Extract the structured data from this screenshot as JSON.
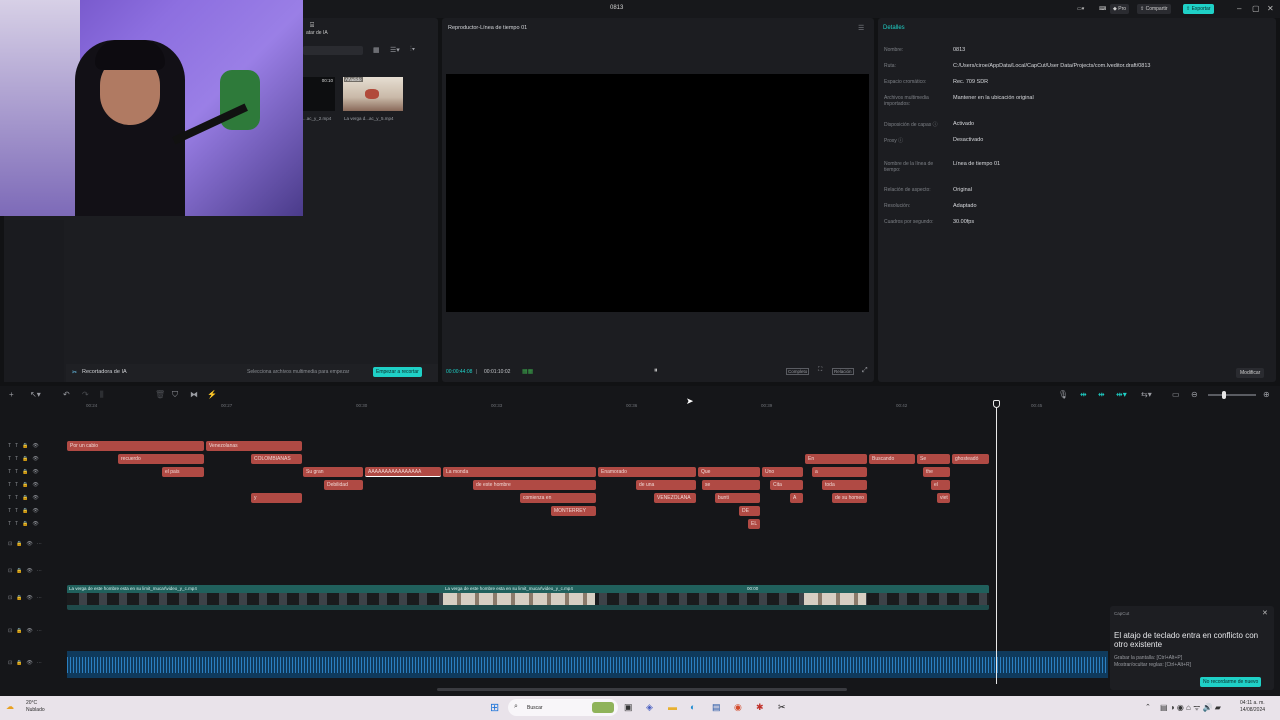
{
  "app": {
    "title": "0813"
  },
  "titlebar": {
    "pro_label": "Pro",
    "share_label": "Compartir",
    "export_label": "Exportar",
    "accent": "#1fd1c7"
  },
  "media": {
    "ai_tab_label": "atar de IA",
    "clips": [
      {
        "duration": "00:10",
        "name": "...ac_y_2.mp4"
      },
      {
        "badge": "Añadido",
        "name": "La verga d...ac_y_5.mp4"
      }
    ],
    "footer_title": "Recortadora de IA",
    "footer_hint": "Selecciona archivos multimedia para empezar",
    "footer_button": "Empezar a recortar"
  },
  "player": {
    "title": "Reproductor-Línea de tiempo 01",
    "current_time": "00:00:44:08",
    "total_time": "00:01:10:02",
    "ratio_label": "Completo",
    "ratio_label2": "Relación"
  },
  "details": {
    "header": "Detalles",
    "rows": [
      {
        "label": "Nombre:",
        "value": "0813"
      },
      {
        "label": "Ruta:",
        "value": "C:/Users/ciroe/AppData/Local/CapCut/User Data/Projects/com.lveditor.draft/0813"
      },
      {
        "label": "Espacio cromático:",
        "value": "Rec. 709 SDR"
      },
      {
        "label": "Archivos multimedia importados:",
        "value": "Mantener en la ubicación original"
      },
      {
        "label": "Disposición de capas ⓘ",
        "value": "Activado"
      },
      {
        "label": "Proxy ⓘ",
        "value": "Desactivado"
      },
      {
        "label": "Nombre de la línea de tiempo:",
        "value": "Línea de tiempo 01"
      },
      {
        "label": "Relación de aspecto:",
        "value": "Original"
      },
      {
        "label": "Resolución:",
        "value": "Adaptado"
      },
      {
        "label": "Cuadros por segundo:",
        "value": "30.00fps"
      }
    ],
    "modify_button": "Modificar"
  },
  "timeline": {
    "ruler": [
      "00:24",
      "00:27",
      "00:30",
      "00:33",
      "00:36",
      "00:39",
      "00:42",
      "00:45"
    ],
    "text_clips": [
      "Por un cabio",
      "Venezolanas",
      "recuerdo",
      "COLOMBIANAS",
      "el pais",
      "Su gran",
      "AAAAAAAAAAAAAAAA",
      "La monda",
      "Enamorado",
      "Que",
      "Uno",
      "En",
      "Buscando",
      "Se",
      "ghosteadó",
      "Debilidad",
      "de este hombre",
      "de una",
      "se",
      "Cita",
      "a",
      "toda",
      "the",
      "y",
      "comienza en",
      "VENEZOLANA",
      "bunti",
      "A",
      "de su homeo",
      "el",
      "viet",
      "MONTERREY",
      "DE",
      "EL"
    ],
    "video_clip_label": "La verga de este hombre esta en su limit_mucar\\video_y_c.mp4",
    "video_clip_label2": "00:00"
  },
  "toast": {
    "app": "CapCut",
    "title": "El atajo de teclado entra en conflicto con otro existente",
    "line1": "Grabar la pantalla: [Ctrl+Alt+P]",
    "line2": "Mostrar/ocultar reglas: [Ctrl+Alt+R]",
    "button": "No recordarme de nuevo"
  },
  "taskbar": {
    "weather_temp": "20°C",
    "weather_desc": "Nublado",
    "search_placeholder": "Buscar",
    "time": "04:11 a. m.",
    "date": "14/08/2024"
  }
}
